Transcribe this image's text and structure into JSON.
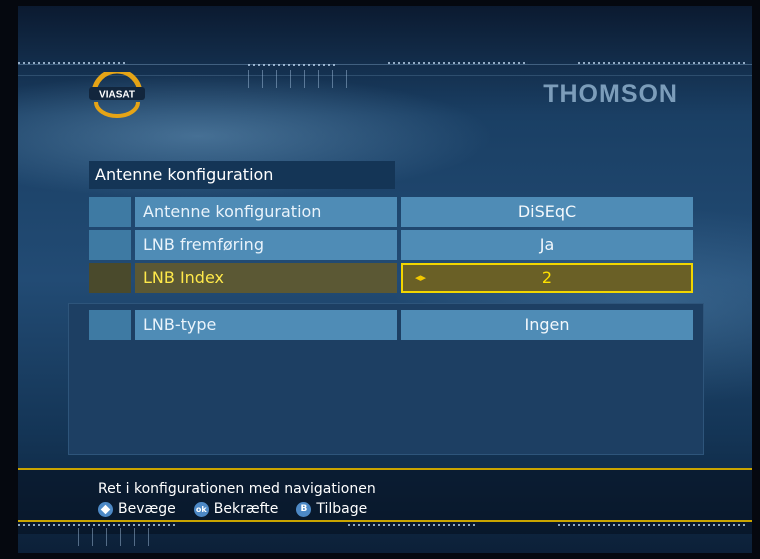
{
  "header": {
    "provider_logo_text": "VIASAT",
    "brand": "THOMSON"
  },
  "menu": {
    "title": "Antenne konfiguration",
    "rows": [
      {
        "label": "Antenne konfiguration",
        "value": "DiSEqC",
        "selected": false
      },
      {
        "label": "LNB fremføring",
        "value": "Ja",
        "selected": false
      },
      {
        "label": "LNB Index",
        "value": "2",
        "selected": true
      },
      {
        "label": "LNB-type",
        "value": "Ingen",
        "selected": false
      }
    ]
  },
  "footer": {
    "help_text": "Ret i konfigurationen med navigationen",
    "legend": [
      {
        "icon": "navigation-diamond-icon",
        "label": "Bevæge"
      },
      {
        "icon": "ok-button-icon",
        "key": "ok",
        "label": "Bekræfte"
      },
      {
        "icon": "back-button-icon",
        "key": "B",
        "label": "Tilbage"
      }
    ]
  },
  "colors": {
    "highlight_border": "#f2d600",
    "highlight_text": "#ffe100",
    "row_background": "#4f8cb6",
    "footer_rule": "#c9a400"
  }
}
